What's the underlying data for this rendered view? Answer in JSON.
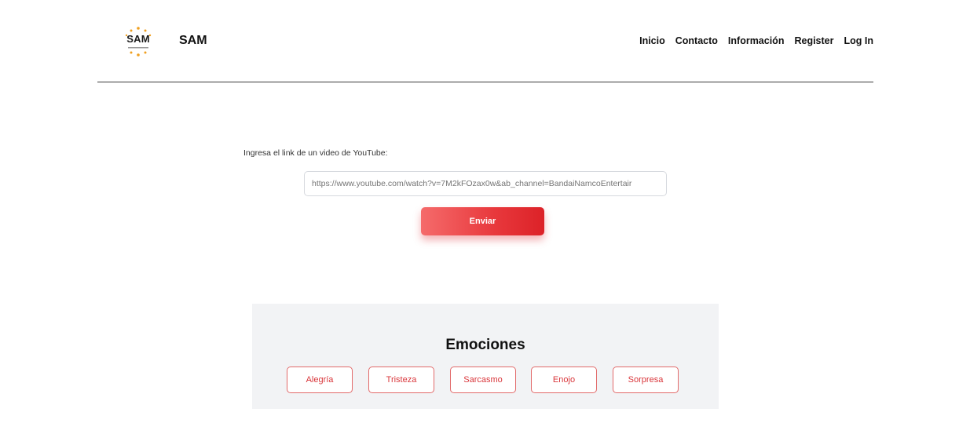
{
  "header": {
    "logo_text": "SAM",
    "brand": "SAM",
    "nav": [
      "Inicio",
      "Contacto",
      "Información",
      "Register",
      "Log In"
    ]
  },
  "form": {
    "label": "Ingresa el link de un video de YouTube:",
    "placeholder": "https://www.youtube.com/watch?v=7M2kFOzax0w&ab_channel=BandaiNamcoEntertair",
    "submit_label": "Enviar"
  },
  "emotions": {
    "title": "Emociones",
    "items": [
      "Alegría",
      "Tristeza",
      "Sarcasmo",
      "Enojo",
      "Sorpresa"
    ]
  },
  "colors": {
    "accent": "#e8383c",
    "logo_dots": "#f0a020",
    "panel_bg": "#f2f3f5"
  },
  "icons": {
    "logo": "sun-dots-logo-icon"
  }
}
